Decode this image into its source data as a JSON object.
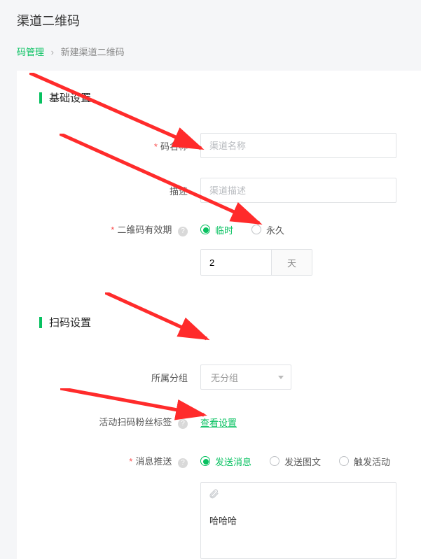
{
  "page_title": "渠道二维码",
  "breadcrumb": {
    "link": "码管理",
    "sep": "›",
    "current": "新建渠道二维码"
  },
  "sections": {
    "basic": "基础设置",
    "scan": "扫码设置"
  },
  "labels": {
    "code_name": "码名称",
    "desc": "描述",
    "validity": "二维码有效期",
    "group": "所属分组",
    "fan_tag": "活动扫码粉丝标签",
    "push": "消息推送"
  },
  "placeholders": {
    "code_name": "渠道名称",
    "desc": "渠道描述"
  },
  "validity": {
    "temp": "临时",
    "perm": "永久",
    "duration_value": "2",
    "duration_unit": "天"
  },
  "group_select": "无分组",
  "fan_tag_link": "查看设置",
  "push_options": {
    "send_msg": "发送消息",
    "send_media": "发送图文",
    "trigger_activity": "触发活动"
  },
  "msg_content": "哈哈哈",
  "help_mark": "?"
}
